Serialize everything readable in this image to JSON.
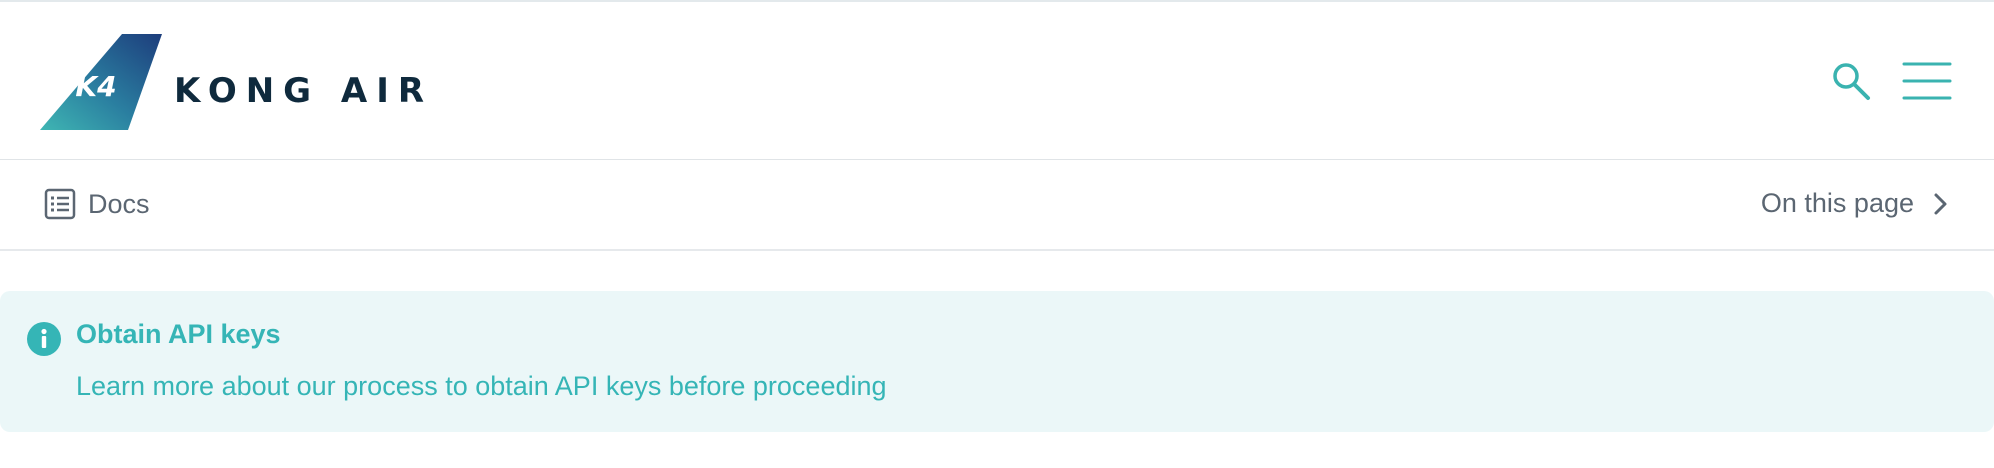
{
  "brand": {
    "name": "KONG AIR",
    "tail_mark": "K4",
    "logo_gradient": [
      "#1d3d7c",
      "#3fb6b3"
    ],
    "text_color": "#0f2a3d"
  },
  "header": {
    "search_icon": "search-icon",
    "menu_icon": "hamburger-menu-icon",
    "accent": "#3ab3b0"
  },
  "docsbar": {
    "docs_label": "Docs",
    "docs_icon": "list-document-icon",
    "on_this_page_label": "On this page",
    "chevron_icon": "chevron-right-icon"
  },
  "callout": {
    "icon": "info-icon",
    "title": "Obtain API keys",
    "text": "Learn more about our process to obtain API keys before proceeding",
    "background": "#ebf7f8",
    "color": "#35b5b6"
  }
}
